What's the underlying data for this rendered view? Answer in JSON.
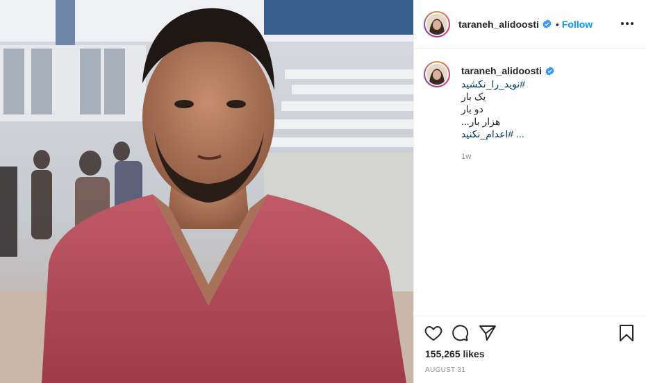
{
  "post": {
    "username": "taraneh_alidoosti",
    "follow_label": "Follow",
    "separator": "•",
    "caption": {
      "username": "taraneh_alidoosti",
      "lines": [
        "#نوید_را_نکشید",
        "یک بار",
        "دو بار",
        "هزار بار...",
        "... #اعدام_نکنید"
      ],
      "hashtag_lines": [
        0,
        4
      ],
      "time": "1w"
    },
    "likes": "155,265 likes",
    "date": "AUGUST 31"
  },
  "icons": {
    "verified": "verified-badge-icon",
    "more": "more-options-icon",
    "like": "heart-icon",
    "comment": "comment-icon",
    "share": "share-icon",
    "save": "bookmark-icon"
  },
  "colors": {
    "accent": "#0095f6",
    "hashtag": "#00376b",
    "muted": "#8e8e8e",
    "text": "#262626",
    "shirt": "#b8505e"
  }
}
